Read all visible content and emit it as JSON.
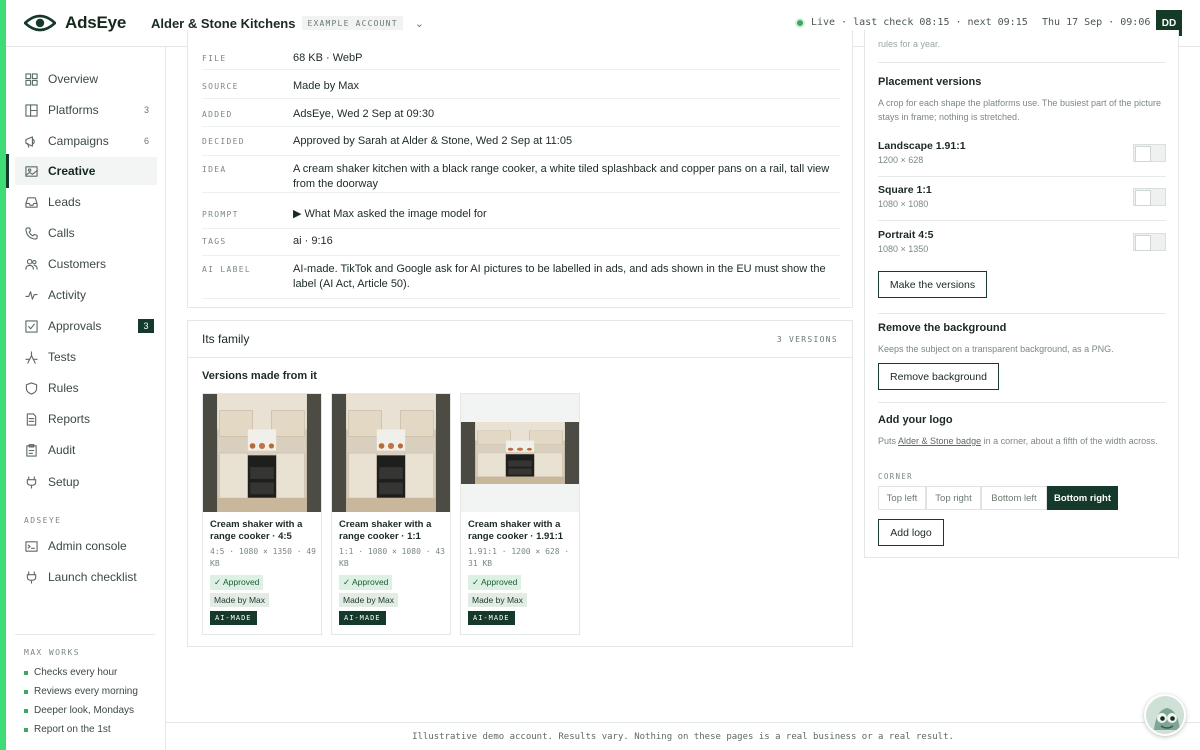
{
  "brand": {
    "name": "AdsEye",
    "accent": "#3ddc74",
    "dark": "#15392a"
  },
  "topbar": {
    "account_name": "Alder & Stone Kitchens",
    "account_tag": "EXAMPLE ACCOUNT",
    "live_text": "Live · last check 08:15 · next 09:15",
    "date_text": "Thu 17 Sep · 09:06",
    "user_initials": "DD"
  },
  "sidebar": {
    "items": [
      {
        "label": "Overview",
        "icon": "grid-icon"
      },
      {
        "label": "Platforms",
        "icon": "layout-icon",
        "count": "3"
      },
      {
        "label": "Campaigns",
        "icon": "megaphone-icon",
        "count": "6"
      },
      {
        "label": "Creative",
        "icon": "image-icon",
        "active": true
      },
      {
        "label": "Leads",
        "icon": "inbox-icon"
      },
      {
        "label": "Calls",
        "icon": "phone-icon"
      },
      {
        "label": "Customers",
        "icon": "users-icon"
      },
      {
        "label": "Activity",
        "icon": "pulse-icon"
      },
      {
        "label": "Approvals",
        "icon": "checkbox-icon",
        "badge": "3"
      },
      {
        "label": "Tests",
        "icon": "split-icon"
      },
      {
        "label": "Rules",
        "icon": "shield-icon"
      },
      {
        "label": "Reports",
        "icon": "file-icon"
      },
      {
        "label": "Audit",
        "icon": "clipboard-icon"
      },
      {
        "label": "Setup",
        "icon": "plug-icon"
      }
    ],
    "section_label": "ADSEYE",
    "admin_items": [
      {
        "label": "Admin console",
        "icon": "console-icon"
      },
      {
        "label": "Launch checklist",
        "icon": "plug-icon"
      }
    ],
    "max_works_label": "MAX WORKS",
    "max_works": [
      "Checks every hour",
      "Reviews every morning",
      "Deeper look, Mondays",
      "Report on the 1st"
    ]
  },
  "details": [
    {
      "key": "FILE",
      "value": "68 KB · WebP"
    },
    {
      "key": "SOURCE",
      "value": "Made by Max"
    },
    {
      "key": "ADDED",
      "value": "AdsEye, Wed 2 Sep at 09:30"
    },
    {
      "key": "DECIDED",
      "value": "Approved by Sarah at Alder & Stone, Wed 2 Sep at 11:05"
    },
    {
      "key": "IDEA",
      "value": "A cream shaker kitchen with a black range cooker, a white tiled splashback and copper pans on a rail, tall view from the doorway"
    },
    {
      "key": "PROMPT",
      "value": "▶  What Max asked the image model for"
    },
    {
      "key": "TAGS",
      "value": "ai · 9:16"
    },
    {
      "key": "AI LABEL",
      "value": "AI-made. TikTok and Google ask for AI pictures to be labelled in ads, and ads shown in the EU must show the label (AI Act, Article 50)."
    }
  ],
  "family": {
    "title": "Its family",
    "count_label": "3 VERSIONS",
    "subtitle": "Versions made from it",
    "versions": [
      {
        "title": "Cream shaker with a range cooker · 4:5",
        "meta": "4:5 · 1080 × 1350 · 49 KB",
        "status": "✓ Approved",
        "source": "Made by Max",
        "ai": "AI-MADE"
      },
      {
        "title": "Cream shaker with a range cooker · 1:1",
        "meta": "1:1 · 1080 × 1080 · 43 KB",
        "status": "✓ Approved",
        "source": "Made by Max",
        "ai": "AI-MADE"
      },
      {
        "title": "Cream shaker with a range cooker · 1.91:1",
        "meta": "1.91:1 · 1200 × 628 · 31 KB",
        "status": "✓ Approved",
        "source": "Made by Max",
        "ai": "AI-MADE"
      }
    ]
  },
  "right": {
    "top_cut_text": "rules for a year.",
    "placement_title": "Placement versions",
    "placement_desc": "A crop for each shape the platforms use. The busiest part of the picture stays in frame; nothing is stretched.",
    "placements": [
      {
        "name": "Landscape 1.91:1",
        "size": "1200 × 628",
        "enabled": false
      },
      {
        "name": "Square 1:1",
        "size": "1080 × 1080",
        "enabled": false
      },
      {
        "name": "Portrait 4:5",
        "size": "1080 × 1350",
        "enabled": false
      }
    ],
    "make_versions_label": "Make the versions",
    "remove_bg_title": "Remove the background",
    "remove_bg_desc": "Keeps the subject on a transparent background, as a PNG.",
    "remove_bg_button": "Remove background",
    "logo_title": "Add your logo",
    "logo_desc_pre": "Puts ",
    "logo_desc_link": "Alder & Stone badge",
    "logo_desc_post": " in a corner, about a fifth of the width across.",
    "corner_label": "CORNER",
    "corners": [
      "Top left",
      "Top right",
      "Bottom left",
      "Bottom right"
    ],
    "corner_selected": "Bottom right",
    "add_logo_button": "Add logo"
  },
  "footer": {
    "text": "Illustrative demo account. Results vary. Nothing on these pages is a real business or a real result."
  }
}
